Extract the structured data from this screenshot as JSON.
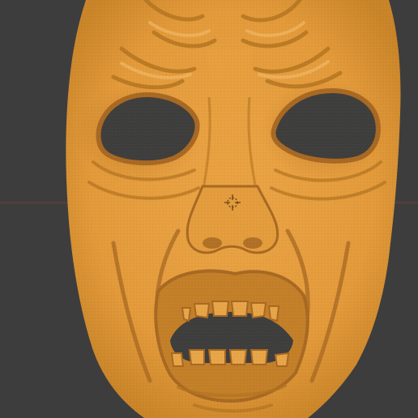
{
  "viewport": {
    "background_color": "#3d3d3d",
    "grid_x_axis_color": "#8a3a3a",
    "grid_y_axis_color": "#6b8a3a"
  },
  "model": {
    "name": "",
    "material_color": "#e39a3a",
    "shadow_color": "#a86822",
    "highlight_color": "#f0b560",
    "wireframe_overlay": true
  },
  "cursor_3d": {
    "icon": "3d-cursor-icon",
    "color": "#7a4a1a"
  }
}
